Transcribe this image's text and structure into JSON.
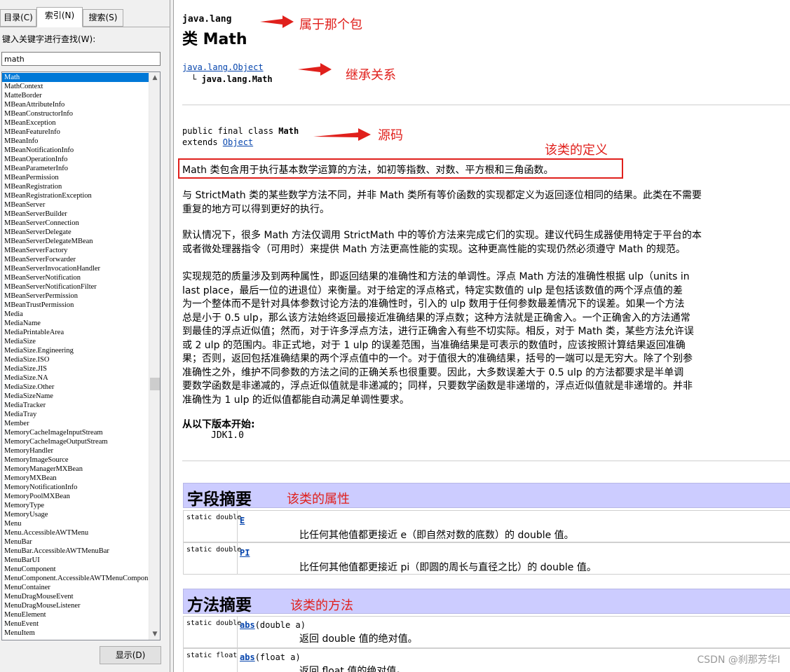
{
  "left_pane": {
    "tabs": [
      "目录(C)",
      "索引(N)",
      "搜索(S)"
    ],
    "keyword_label": "键入关键字进行查找(W):",
    "search_value": "math",
    "items": [
      "Math",
      "MathContext",
      "MatteBorder",
      "MBeanAttributeInfo",
      "MBeanConstructorInfo",
      "MBeanException",
      "MBeanFeatureInfo",
      "MBeanInfo",
      "MBeanNotificationInfo",
      "MBeanOperationInfo",
      "MBeanParameterInfo",
      "MBeanPermission",
      "MBeanRegistration",
      "MBeanRegistrationException",
      "MBeanServer",
      "MBeanServerBuilder",
      "MBeanServerConnection",
      "MBeanServerDelegate",
      "MBeanServerDelegateMBean",
      "MBeanServerFactory",
      "MBeanServerForwarder",
      "MBeanServerInvocationHandler",
      "MBeanServerNotification",
      "MBeanServerNotificationFilter",
      "MBeanServerPermission",
      "MBeanTrustPermission",
      "Media",
      "MediaName",
      "MediaPrintableArea",
      "MediaSize",
      "MediaSize.Engineering",
      "MediaSize.ISO",
      "MediaSize.JIS",
      "MediaSize.NA",
      "MediaSize.Other",
      "MediaSizeName",
      "MediaTracker",
      "MediaTray",
      "Member",
      "MemoryCacheImageInputStream",
      "MemoryCacheImageOutputStream",
      "MemoryHandler",
      "MemoryImageSource",
      "MemoryManagerMXBean",
      "MemoryMXBean",
      "MemoryNotificationInfo",
      "MemoryPoolMXBean",
      "MemoryType",
      "MemoryUsage",
      "Menu",
      "Menu.AccessibleAWTMenu",
      "MenuBar",
      "MenuBar.AccessibleAWTMenuBar",
      "MenuBarUI",
      "MenuComponent",
      "MenuComponent.AccessibleAWTMenuCompon",
      "MenuContainer",
      "MenuDragMouseEvent",
      "MenuDragMouseListener",
      "MenuElement",
      "MenuEvent",
      "MenuItem"
    ],
    "display_button": "显示(D)"
  },
  "doc": {
    "package": "java.lang",
    "class_title": "类 Math",
    "inherit_parent": "java.lang.Object",
    "inherit_child": "java.lang.Math",
    "decl_prefix": "public final class ",
    "decl_class": "Math",
    "decl_extends": "extends ",
    "decl_object": "Object",
    "definition": "Math 类包含用于执行基本数学运算的方法，如初等指数、对数、平方根和三角函数。",
    "para1": "与 StrictMath 类的某些数学方法不同，并非 Math 类所有等价函数的实现都定义为返回逐位相同的结果。此类在不需要\n重复的地方可以得到更好的执行。",
    "para2": "默认情况下，很多 Math 方法仅调用 StrictMath 中的等价方法来完成它们的实现。建议代码生成器使用特定于平台的本\n或者微处理器指令（可用时）来提供 Math 方法更高性能的实现。这种更高性能的实现仍然必须遵守 Math 的规范。",
    "para3": "实现规范的质量涉及到两种属性，即返回结果的准确性和方法的单调性。浮点 Math 方法的准确性根据 ulp（units in\nlast place，最后一位的进退位）来衡量。对于给定的浮点格式，特定实数值的 ulp 是包括该数值的两个浮点值的差\n为一个整体而不是针对具体参数讨论方法的准确性时，引入的 ulp 数用于任何参数最差情况下的误差。如果一个方法\n总是小于 0.5 ulp，那么该方法始终返回最接近准确结果的浮点数；这种方法就是正确舍入。一个正确舍入的方法通常\n到最佳的浮点近似值；然而，对于许多浮点方法，进行正确舍入有些不切实际。相反，对于 Math 类，某些方法允许误\n或 2 ulp 的范围内。非正式地，对于 1 ulp 的误差范围，当准确结果是可表示的数值时，应该按照计算结果返回准确\n果；否则，返回包括准确结果的两个浮点值中的一个。对于值很大的准确结果，括号的一端可以是无穷大。除了个别参\n准确性之外，维护不同参数的方法之间的正确关系也很重要。因此，大多数误差大于 0.5 ulp 的方法都要求是半单调\n要数学函数是非递减的，浮点近似值就是非递减的；同样，只要数学函数是非递增的，浮点近似值就是非递增的。并非\n准确性为 1 ulp 的近似值都能自动满足单调性要求。",
    "since_label": "从以下版本开始:",
    "since_value": "JDK1.0",
    "fields_title": "字段摘要",
    "fields": [
      {
        "type": "static double",
        "name": "E",
        "desc": "比任何其他值都更接近 e（即自然对数的底数）的 double 值。"
      },
      {
        "type": "static double",
        "name": "PI",
        "desc": "比任何其他值都更接近 pi（即圆的周长与直径之比）的 double 值。"
      }
    ],
    "methods_title": "方法摘要",
    "methods": [
      {
        "type": "static double",
        "name": "abs",
        "sig": "(double a)",
        "desc": "返回 double 值的绝对值。"
      },
      {
        "type": "static float",
        "name": "abs",
        "sig": "(float a)",
        "desc": "返回 float 值的绝对值。"
      }
    ]
  },
  "annotations": {
    "package": "属于那个包",
    "inheritance": "继承关系",
    "source": "源码",
    "definition": "该类的定义",
    "fields": "该类的属性",
    "methods": "该类的方法"
  },
  "watermark": "CSDN @刹那芳华I",
  "colors": {
    "annotation": "#e0201c",
    "section_header": "#ccccff",
    "link": "#0645ad",
    "selection": "#0078d7"
  }
}
